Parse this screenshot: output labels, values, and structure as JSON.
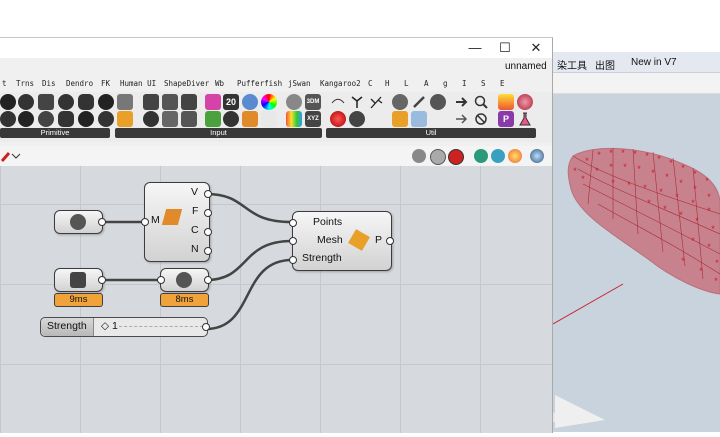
{
  "window": {
    "doc_name": "unnamed",
    "minimize": "—",
    "maximize": "☐",
    "close": "✕"
  },
  "rhino": {
    "tabs": [
      "染工具",
      "出图",
      "New in V7"
    ]
  },
  "menubar": [
    "t",
    "Trns",
    "Dis",
    "Dendro",
    "FK",
    "Human UI",
    "ShapeDiver",
    "Wb",
    "Pufferfish",
    "jSwan",
    "Kangaroo2",
    "C",
    "H",
    "L",
    "A",
    "g",
    "I",
    "S",
    "E"
  ],
  "ribbon": {
    "groups": [
      "Primitive",
      "Input",
      "Util"
    ],
    "slider_label": "20",
    "xyz_label": "XYZ",
    "3dm_label": "3DM"
  },
  "canvas": {
    "comp1": {
      "input": "M",
      "outputs": [
        "V",
        "F",
        "C",
        "N"
      ]
    },
    "comp2": {
      "inputs": [
        "Points",
        "Mesh",
        "Strength"
      ],
      "output": "P"
    },
    "timers": [
      "9ms",
      "8ms"
    ],
    "slider": {
      "name": "Strength",
      "value": "◇ 1"
    }
  }
}
